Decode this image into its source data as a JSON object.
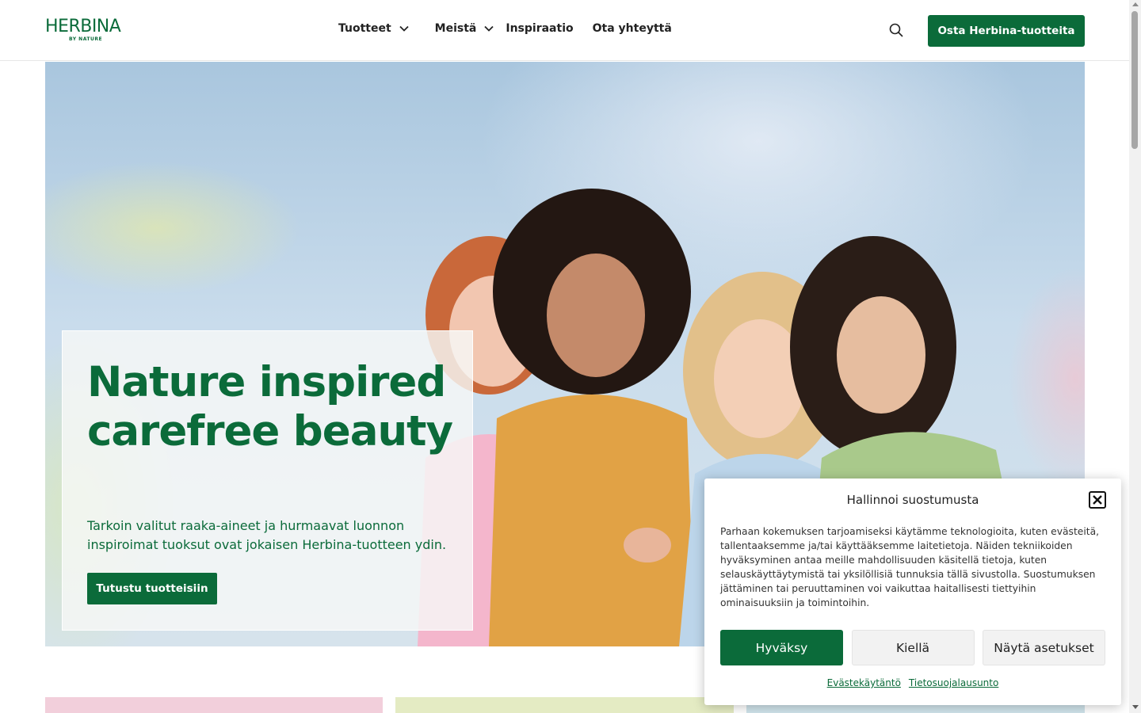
{
  "brand": {
    "name": "HERBINA",
    "tagline": "BY NATURE",
    "color": "#0b6b3a"
  },
  "nav": {
    "items": [
      {
        "label": "Tuotteet",
        "has_dropdown": true
      },
      {
        "label": "Meistä",
        "has_dropdown": true
      },
      {
        "label": "Inspiraatio",
        "has_dropdown": false
      },
      {
        "label": "Ota yhteyttä",
        "has_dropdown": false
      }
    ],
    "search_icon": "search-icon",
    "cta_label": "Osta Herbina-tuotteita"
  },
  "hero": {
    "title": "Nature inspired carefree beauty",
    "text": "Tarkoin valitut raaka-aineet ja hurmaavat luonnon inspiroimat tuoksut ovat jokaisen Herbina-tuotteen ydin.",
    "button_label": "Tutustu tuotteisiin"
  },
  "consent": {
    "title": "Hallinnoi suostumusta",
    "close_icon": "close-icon",
    "text": "Parhaan kokemuksen tarjoamiseksi käytämme teknologioita, kuten evästeitä, tallentaaksemme ja/tai käyttääksemme laitetietoja. Näiden tekniikoiden hyväksyminen antaa meille mahdollisuuden käsitellä tietoja, kuten selauskäyttäytymistä tai yksilöllisiä tunnuksia tällä sivustolla. Suostumuksen jättäminen tai peruuttaminen voi vaikuttaa haitallisesti tiettyihin ominaisuuksiin ja toimintoihin.",
    "accept_label": "Hyväksy",
    "deny_label": "Kiellä",
    "settings_label": "Näytä asetukset",
    "links": [
      "Evästekäytäntö",
      "Tietosuojalausunto"
    ]
  }
}
